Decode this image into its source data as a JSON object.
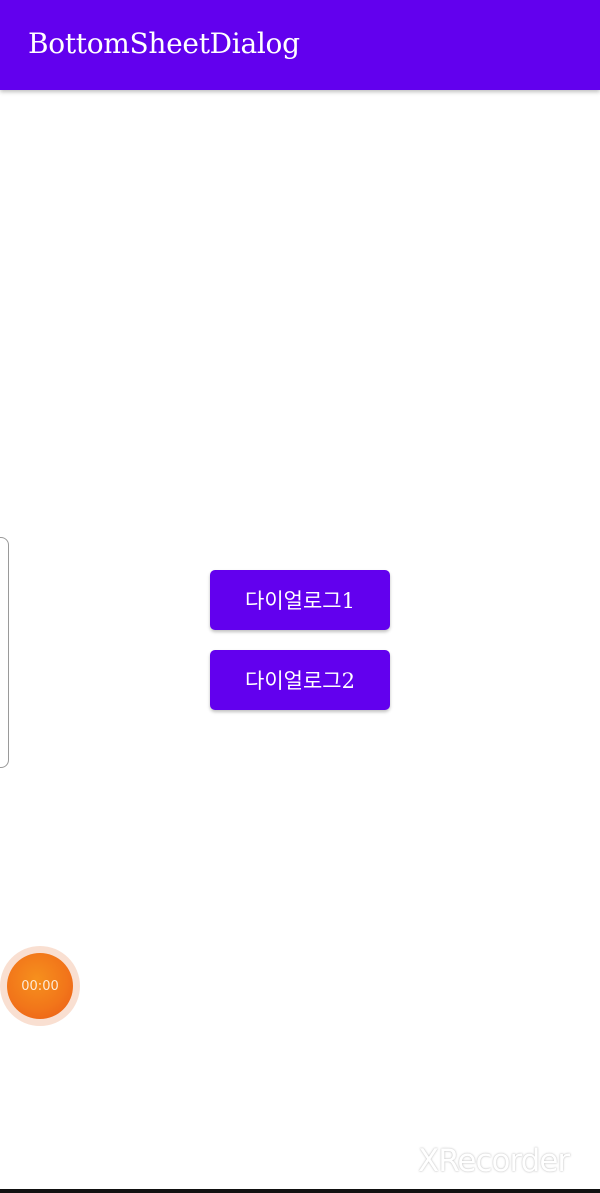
{
  "app_bar": {
    "title": "BottomSheetDialog",
    "color": "#6200ee"
  },
  "buttons": {
    "dialog1_label": "다이얼로그1",
    "dialog2_label": "다이얼로그2"
  },
  "recorder": {
    "timer": "00:00",
    "watermark": "XRecorder",
    "accent": "#f2761a"
  }
}
